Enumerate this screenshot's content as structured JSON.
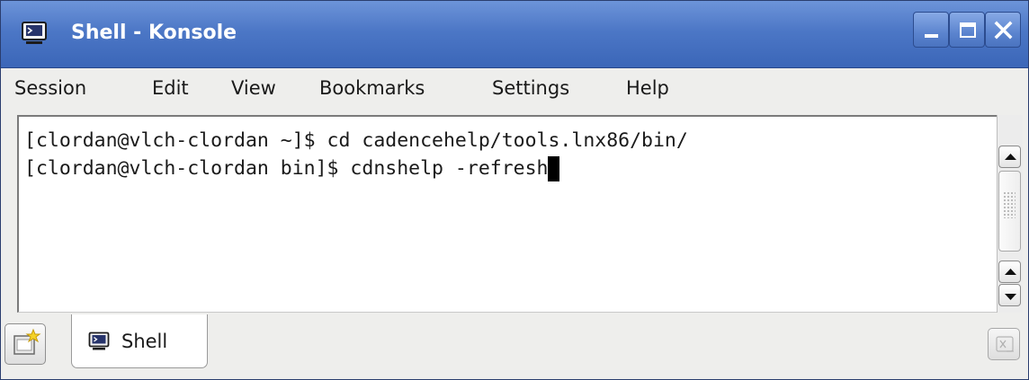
{
  "window": {
    "title": "Shell - Konsole",
    "title_icon": "konsole-icon",
    "buttons": [
      "minimize-icon",
      "maximize-icon",
      "close-icon"
    ],
    "titlebar_color": "#4c77c6"
  },
  "menu": {
    "items": [
      "Session",
      "Edit",
      "View",
      "Bookmarks",
      "Settings",
      "Help"
    ]
  },
  "terminal": {
    "lines": [
      "[clordan@vlch-clordan ~]$ cd cadencehelp/tools.lnx86/bin/",
      "[clordan@vlch-clordan bin]$ cdnshelp -refresh"
    ],
    "background": "#ffffff",
    "foreground": "#1a1a1a"
  },
  "tabs": {
    "new_tab_icon": "new-session-icon",
    "items": [
      {
        "label": "Shell",
        "icon": "konsole-icon",
        "active": true
      }
    ],
    "close_tab_icon": "close-session-icon"
  }
}
